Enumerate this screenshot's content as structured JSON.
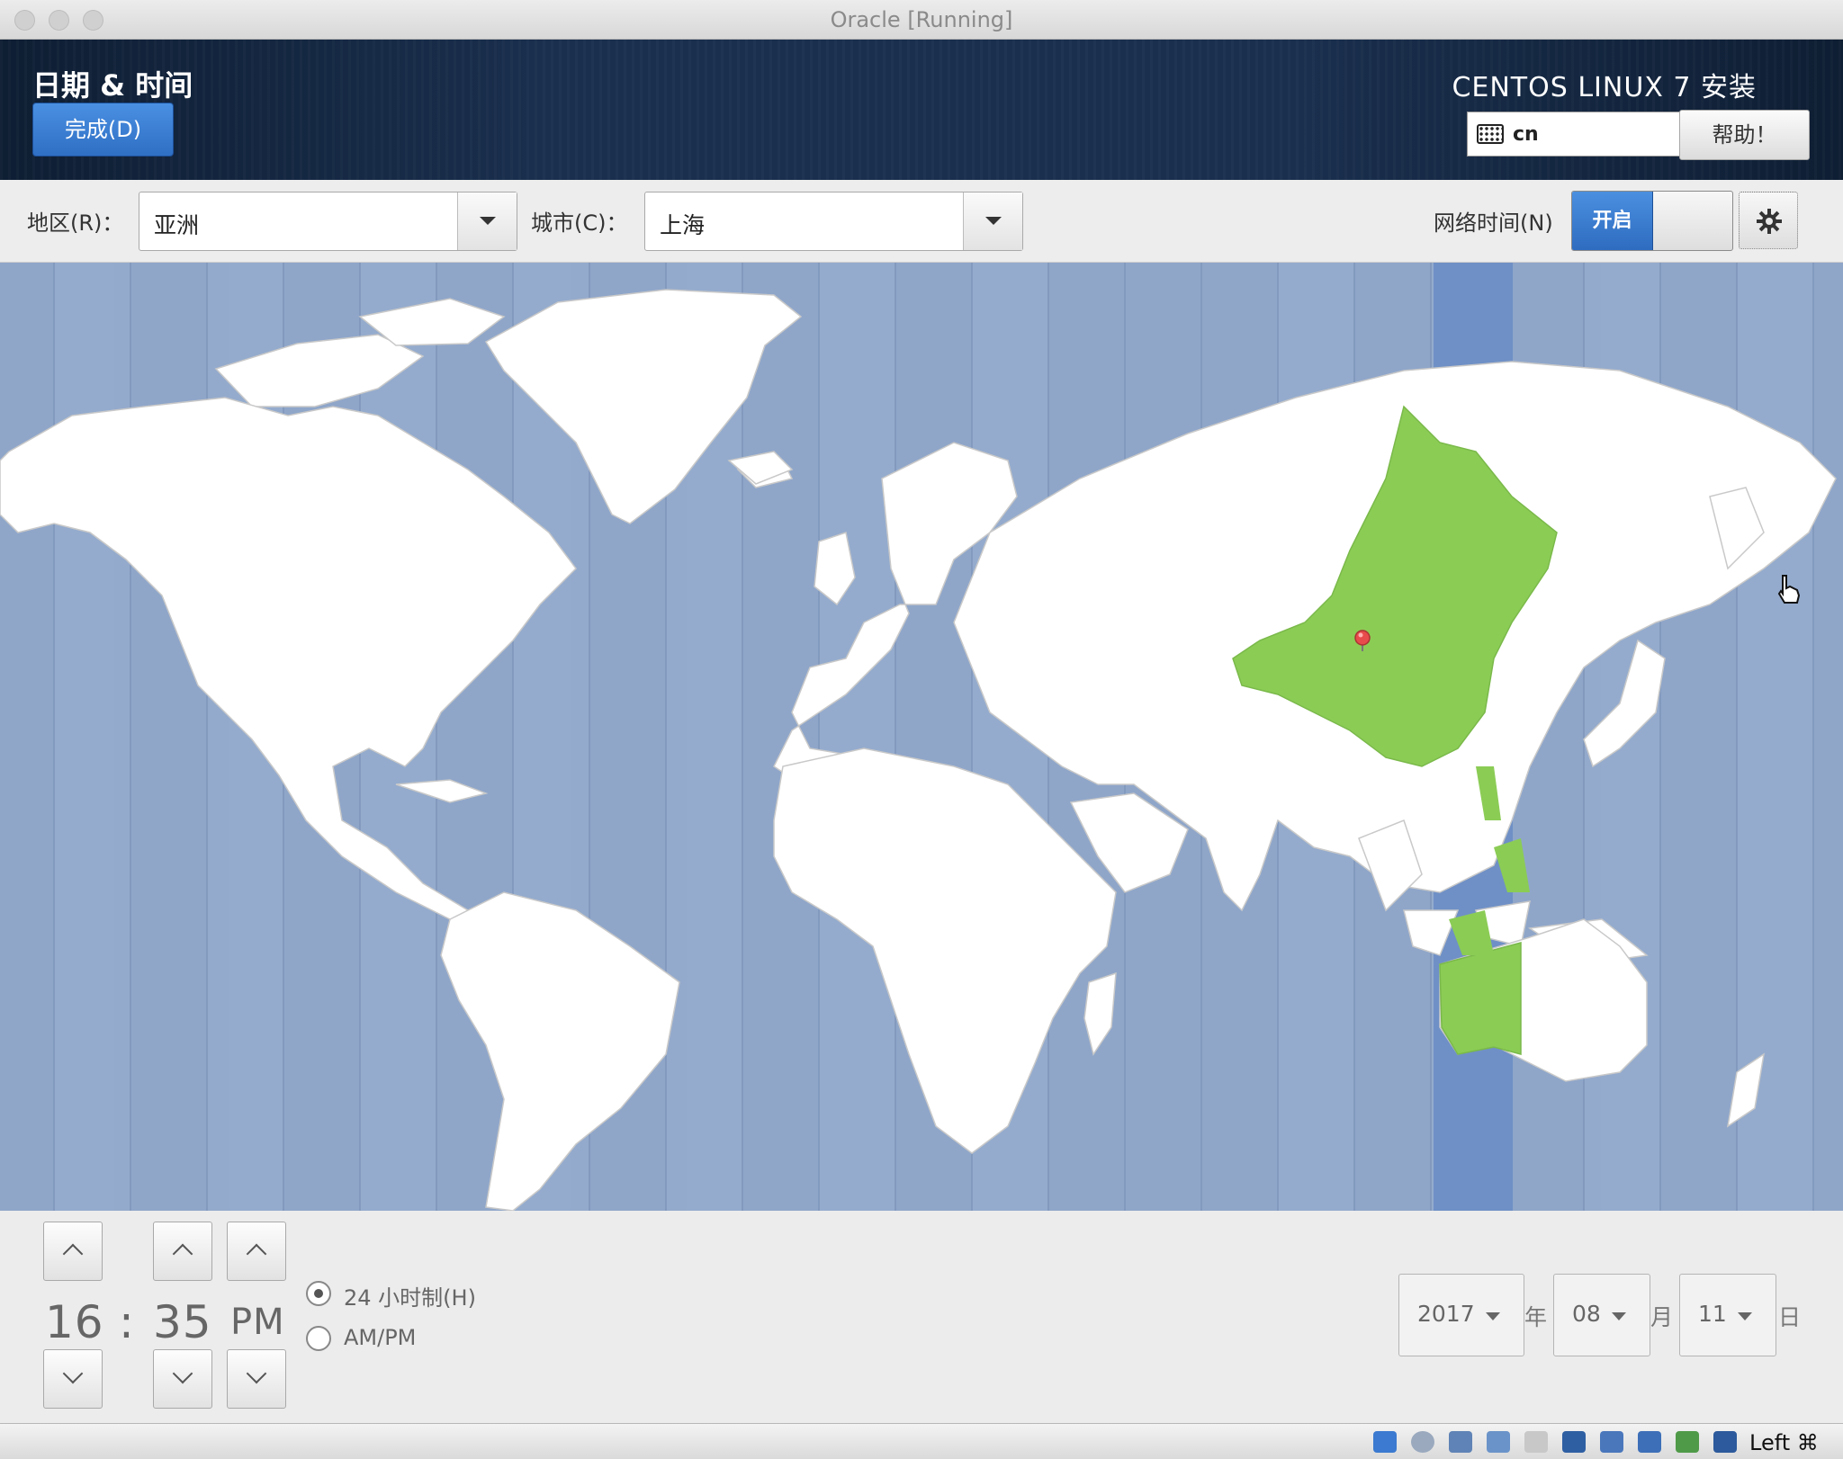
{
  "window": {
    "title": "Oracle [Running]"
  },
  "header": {
    "page_title": "日期 & 时间",
    "done_label": "完成(D)",
    "product_title": "CENTOS LINUX 7 安装",
    "keyboard_layout": "cn",
    "help_label": "帮助！"
  },
  "selectors": {
    "region_label": "地区(R)：",
    "region_value": "亚洲",
    "city_label": "城市(C)：",
    "city_value": "上海",
    "ntp_label": "网络时间(N)",
    "ntp_on_label": "开启",
    "ntp_enabled": true
  },
  "map": {
    "highlight_timezone": "UTC+8",
    "highlight_color": "#8bcc55",
    "land_color": "#ffffff",
    "ocean_color": "#8fa6c9",
    "marker": "location-pin-icon"
  },
  "time": {
    "hours": "16",
    "separator": ":",
    "minutes": "35",
    "ampm": "PM",
    "format_24h_label": "24 小时制(H)",
    "format_ampm_label": "AM/PM",
    "format_selected": "24h"
  },
  "date": {
    "year": "2017",
    "year_unit": "年",
    "month": "08",
    "month_unit": "月",
    "day": "11",
    "day_unit": "日"
  },
  "statusbar": {
    "host_key": "Left ⌘"
  }
}
